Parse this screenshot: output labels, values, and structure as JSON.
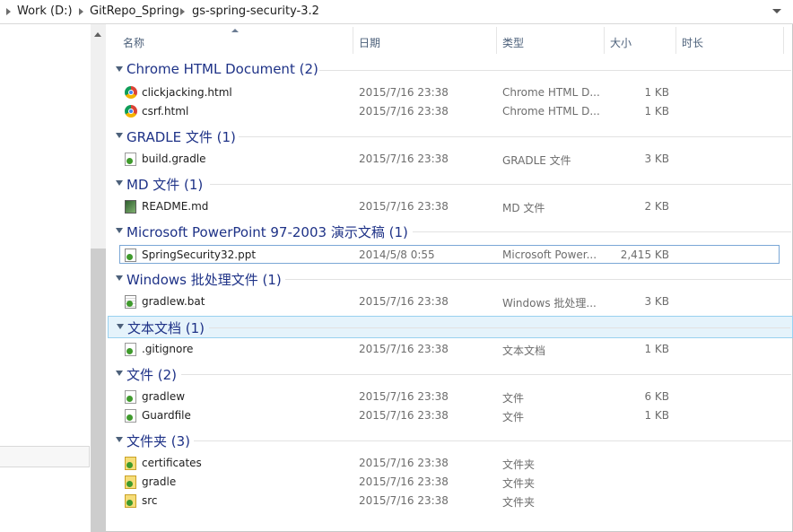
{
  "breadcrumb": [
    "Work (D:)",
    "GitRepo_Spring",
    "gs-spring-security-3.2"
  ],
  "columns": {
    "name": "名称",
    "date": "日期",
    "type": "类型",
    "size": "大小",
    "duration": "时长"
  },
  "groups": [
    {
      "title": "Chrome HTML Document (2)",
      "items": [
        {
          "name": "clickjacking.html",
          "date": "2015/7/16 23:38",
          "type": "Chrome HTML D...",
          "size": "1 KB",
          "icon": "chrome-icon"
        },
        {
          "name": "csrf.html",
          "date": "2015/7/16 23:38",
          "type": "Chrome HTML D...",
          "size": "1 KB",
          "icon": "chrome-icon"
        }
      ]
    },
    {
      "title": "GRADLE 文件 (1)",
      "items": [
        {
          "name": "build.gradle",
          "date": "2015/7/16 23:38",
          "type": "GRADLE 文件",
          "size": "3 KB",
          "icon": "file-icon"
        }
      ]
    },
    {
      "title": "MD 文件 (1)",
      "items": [
        {
          "name": "README.md",
          "date": "2015/7/16 23:38",
          "type": "MD 文件",
          "size": "2 KB",
          "icon": "markdown-file-icon"
        }
      ]
    },
    {
      "title": "Microsoft PowerPoint 97-2003 演示文稿 (1)",
      "items": [
        {
          "name": "SpringSecurity32.ppt",
          "date": "2014/5/8 0:55",
          "type": "Microsoft Power...",
          "size": "2,415 KB",
          "icon": "powerpoint-file-icon"
        }
      ]
    },
    {
      "title": "Windows 批处理文件 (1)",
      "items": [
        {
          "name": "gradlew.bat",
          "date": "2015/7/16 23:38",
          "type": "Windows 批处理...",
          "size": "3 KB",
          "icon": "batch-file-icon"
        }
      ]
    },
    {
      "title": "文本文档 (1)",
      "items": [
        {
          "name": ".gitignore",
          "date": "2015/7/16 23:38",
          "type": "文本文档",
          "size": "1 KB",
          "icon": "text-file-icon"
        }
      ]
    },
    {
      "title": "文件 (2)",
      "items": [
        {
          "name": "gradlew",
          "date": "2015/7/16 23:38",
          "type": "文件",
          "size": "6 KB",
          "icon": "file-icon"
        },
        {
          "name": "Guardfile",
          "date": "2015/7/16 23:38",
          "type": "文件",
          "size": "1 KB",
          "icon": "file-icon"
        }
      ]
    },
    {
      "title": "文件夹 (3)",
      "items": [
        {
          "name": "certificates",
          "date": "2015/7/16 23:38",
          "type": "文件夹",
          "size": "",
          "icon": "folder-icon"
        },
        {
          "name": "gradle",
          "date": "2015/7/16 23:38",
          "type": "文件夹",
          "size": "",
          "icon": "folder-icon"
        },
        {
          "name": "src",
          "date": "2015/7/16 23:38",
          "type": "文件夹",
          "size": "",
          "icon": "folder-icon"
        }
      ]
    }
  ]
}
